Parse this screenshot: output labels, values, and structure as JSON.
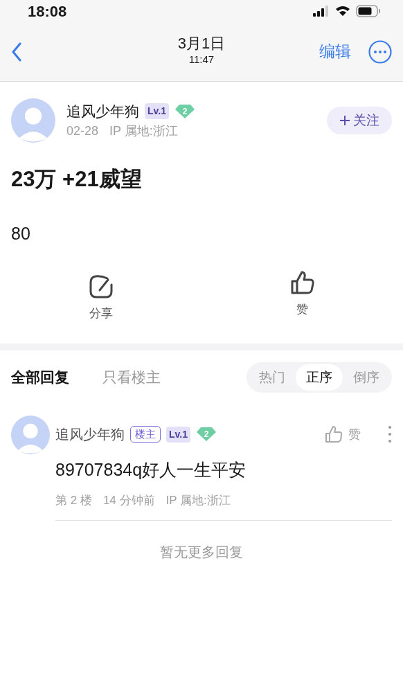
{
  "status_bar": {
    "time": "18:08"
  },
  "nav": {
    "date": "3月1日",
    "time": "11:47",
    "edit": "编辑"
  },
  "post": {
    "author": {
      "name": "追风少年狗",
      "level": "Lv.1",
      "gem": "2",
      "date": "02-28",
      "ip": "IP 属地:浙江"
    },
    "follow": "关注",
    "title": "23万 +21威望",
    "body": "80",
    "actions": [
      {
        "kind": "share",
        "label": "分享"
      },
      {
        "kind": "like",
        "label": "赞"
      }
    ]
  },
  "reply_tabs": [
    {
      "label": "全部回复",
      "selected": true
    },
    {
      "label": "只看楼主",
      "selected": false
    }
  ],
  "sort": [
    {
      "label": "热门",
      "selected": false
    },
    {
      "label": "正序",
      "selected": true
    },
    {
      "label": "倒序",
      "selected": false
    }
  ],
  "replies": [
    {
      "author": "追风少年狗",
      "op_tag": "楼主",
      "level": "Lv.1",
      "gem": "2",
      "like": "赞",
      "content": "89707834q好人一生平安",
      "floor": "第 2 楼",
      "time": "14 分钟前",
      "ip": "IP 属地:浙江"
    }
  ],
  "end_note": "暂无更多回复"
}
